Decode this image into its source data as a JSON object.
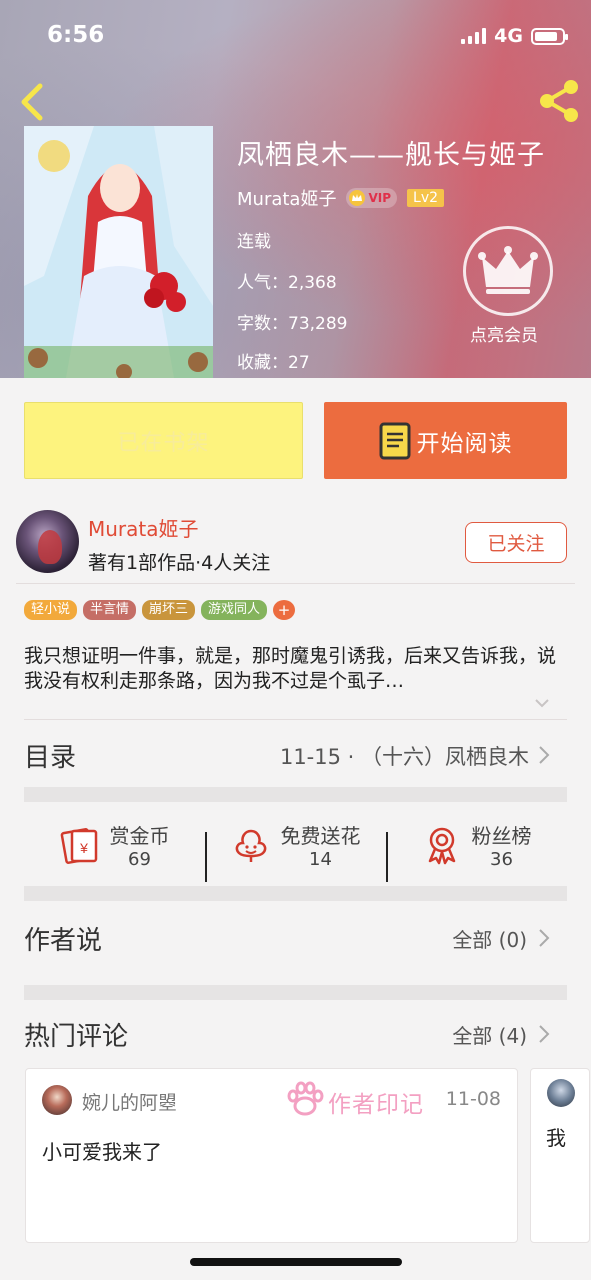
{
  "status_bar": {
    "time": "6:56",
    "network": "4G",
    "battery_level": 0.85
  },
  "book": {
    "title": "凤栖良木——舰长与姬子",
    "author": "Murata姬子",
    "vip_label": "VIP",
    "level": "Lv2",
    "status": "连载",
    "popularity": "人气：2,368",
    "word_count": "字数：73,289",
    "favorites": "收藏：27"
  },
  "member": {
    "label": "点亮会员"
  },
  "actions": {
    "shelf_label": "已在书架",
    "read_label": "开始阅读"
  },
  "author_section": {
    "name": "Murata姬子",
    "stats": "著有1部作品·4人关注",
    "follow_label": "已关注"
  },
  "tags": [
    {
      "label": "轻小说",
      "color": "#f2a93b"
    },
    {
      "label": "半言情",
      "color": "#c56e66"
    },
    {
      "label": "崩坏三",
      "color": "#c9953c"
    },
    {
      "label": "游戏同人",
      "color": "#84b35c"
    }
  ],
  "tag_more": "+",
  "description": "我只想证明一件事，就是，那时魔鬼引诱我，后来又告诉我，说我没有权利走那条路，因为我不过是个虱子…",
  "toc": {
    "label": "目录",
    "latest": "11-15 · （十六）凤栖良木"
  },
  "stats": [
    {
      "label": "赏金币",
      "value": "69",
      "icon": "red-envelope-icon"
    },
    {
      "label": "免费送花",
      "value": "14",
      "icon": "flower-icon"
    },
    {
      "label": "粉丝榜",
      "value": "36",
      "icon": "medal-icon"
    }
  ],
  "author_says": {
    "label": "作者说",
    "all": "全部 (0)"
  },
  "hot_comments": {
    "label": "热门评论",
    "all": "全部 (4)",
    "items": [
      {
        "user": "婉儿的阿曌",
        "badge": "作者印记",
        "date": "11-08",
        "text": "小可爱我来了"
      },
      {
        "text": "我"
      }
    ]
  },
  "colors": {
    "accent": "#ec6c3f",
    "shelf_button": "#fdf37e",
    "author_red": "#e04b36"
  }
}
